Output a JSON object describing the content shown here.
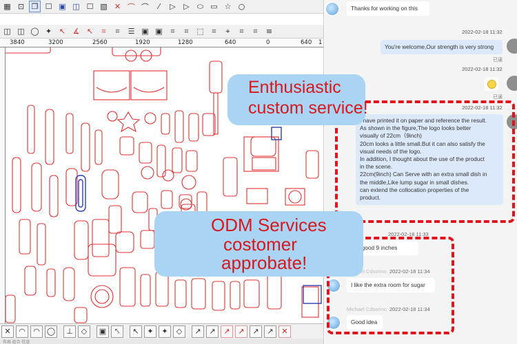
{
  "cad": {
    "ruler_labels": [
      "3840",
      "3200",
      "2560",
      "1920",
      "1280",
      "640",
      "0",
      "640",
      "1"
    ],
    "top_icons_row1": [
      "▦",
      "⊡",
      "❐",
      "☐",
      "▣",
      "◫",
      "☐",
      "▧",
      "✕",
      "⌒",
      "⌒",
      "⁄",
      "▷",
      "▷",
      "⬭",
      "▭",
      "☆",
      "○"
    ],
    "top_icons_row2": [
      "◫",
      "◫",
      "◯",
      "✦",
      "↖",
      "∡",
      "↖",
      "⌗",
      "⌗",
      "☰",
      "▣",
      "▣",
      "⌗",
      "⌗",
      "⬚",
      "⌗",
      "⌖",
      "⌗",
      "⌗",
      "≡"
    ],
    "bottom_icons": [
      "✕",
      "◠",
      "◠",
      "◯",
      "⊥",
      "◇",
      "▣",
      "⤣",
      "↖",
      "✦",
      "✦",
      "◇",
      "↗",
      "↗",
      "↗",
      "↗",
      "↗",
      "↗",
      "✕"
    ],
    "status_text": "布局 组合 信息"
  },
  "chat": {
    "messages": [
      {
        "dir": "in",
        "text": "Thanks for working on this"
      },
      {
        "dir": "out",
        "timestamp": "2022-02-18 11:32",
        "text": "You're welcome,Our strength is very strong",
        "read": "已读"
      },
      {
        "dir": "out",
        "timestamp": "2022-02-18 11:32",
        "emoji": "smiling-face",
        "read": "已读"
      },
      {
        "dir": "out",
        "timestamp": "2022-02-18 11:32",
        "lines": [
          "I have printed it on paper and reference the result.",
          "As shown in the figure,The logo looks better",
          "visually of 22cm（9inch)",
          "20cm looks a little small.But it can also satisfy the",
          "visual needs of the logo.",
          "In addition, I thought about the use of the product",
          "in the scene.",
          "22cm(9inch) Can Serve with an extra small dish in",
          "the middle,Like lump sugar in small dishes.",
          "can extend the collocation properties of the",
          "product."
        ]
      },
      {
        "dir": "in",
        "timestamp": "2022-02-18 11:33",
        "text": "nds good 9 inches"
      },
      {
        "dir": "in",
        "sender": "Michael Cdsorino",
        "timestamp": "2022-02-18 11:34",
        "text": "I like the extra room for sugar"
      },
      {
        "dir": "in",
        "sender": "Michael Cdsorino",
        "timestamp": "2022-02-18 11:34",
        "text": "Good idea"
      }
    ]
  },
  "overlays": {
    "top_pill": [
      "Enthusiastic",
      "custom service!"
    ],
    "bottom_pill": [
      "ODM Services",
      "costomer",
      "approbate!"
    ],
    "accent_color": "#e0141c",
    "pill_color": "#a9d4f3"
  }
}
